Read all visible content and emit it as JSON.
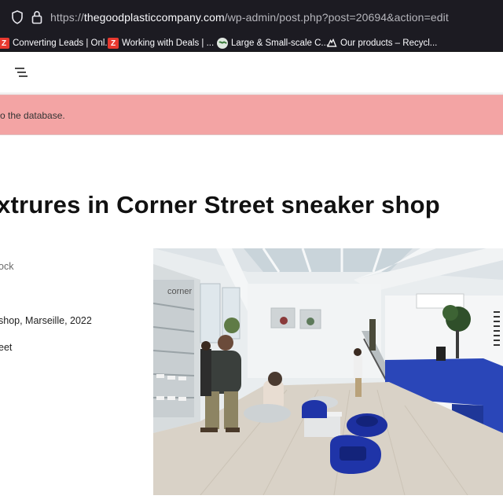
{
  "browser": {
    "url_prefix": "https://",
    "url_domain": "thegoodplasticcompany.com",
    "url_path": "/wp-admin/post.php?post=20694&action=edit",
    "icons": [
      "shield-icon",
      "lock-icon"
    ]
  },
  "bookmarks": [
    {
      "label": "Converting Leads | Onl...",
      "icon": "zoho-icon"
    },
    {
      "label": "Working with Deals | ...",
      "icon": "zoho-icon"
    },
    {
      "label": "Large & Small-scale C...",
      "icon": "globe-icon"
    },
    {
      "label": "Our products – Recycl...",
      "icon": "recycle-icon"
    }
  ],
  "notice": {
    "message": "o the database."
  },
  "post": {
    "title": "xtrures in Corner Street sneaker shop",
    "meta_lines": [
      "ock",
      "shop, Marseille, 2022",
      "eet"
    ],
    "image_sign": "corner"
  },
  "colors": {
    "notice_bg": "#f3a4a4",
    "browser_bg": "#1c1b22",
    "counter_blue": "#2a46b8"
  }
}
